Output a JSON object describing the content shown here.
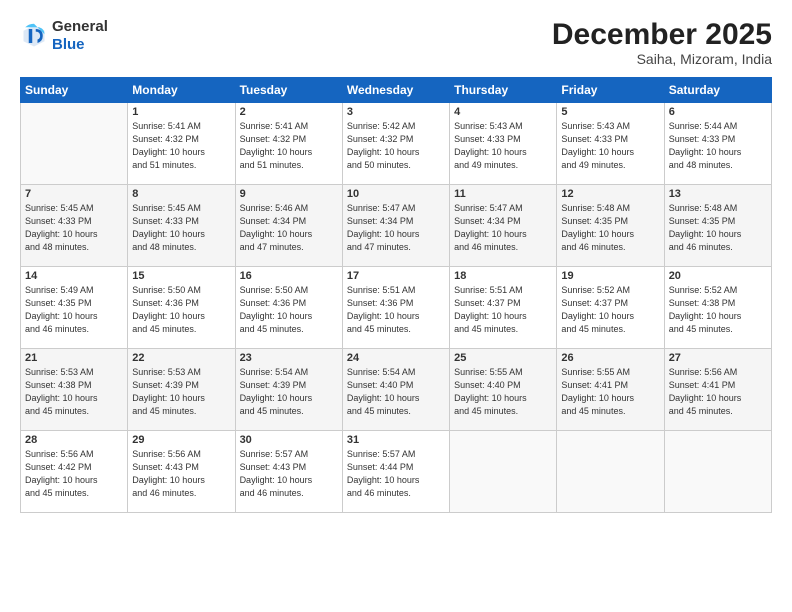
{
  "header": {
    "logo_general": "General",
    "logo_blue": "Blue",
    "month_title": "December 2025",
    "location": "Saiha, Mizoram, India"
  },
  "weekdays": [
    "Sunday",
    "Monday",
    "Tuesday",
    "Wednesday",
    "Thursday",
    "Friday",
    "Saturday"
  ],
  "weeks": [
    [
      {
        "num": "",
        "info": ""
      },
      {
        "num": "1",
        "info": "Sunrise: 5:41 AM\nSunset: 4:32 PM\nDaylight: 10 hours\nand 51 minutes."
      },
      {
        "num": "2",
        "info": "Sunrise: 5:41 AM\nSunset: 4:32 PM\nDaylight: 10 hours\nand 51 minutes."
      },
      {
        "num": "3",
        "info": "Sunrise: 5:42 AM\nSunset: 4:32 PM\nDaylight: 10 hours\nand 50 minutes."
      },
      {
        "num": "4",
        "info": "Sunrise: 5:43 AM\nSunset: 4:33 PM\nDaylight: 10 hours\nand 49 minutes."
      },
      {
        "num": "5",
        "info": "Sunrise: 5:43 AM\nSunset: 4:33 PM\nDaylight: 10 hours\nand 49 minutes."
      },
      {
        "num": "6",
        "info": "Sunrise: 5:44 AM\nSunset: 4:33 PM\nDaylight: 10 hours\nand 48 minutes."
      }
    ],
    [
      {
        "num": "7",
        "info": "Sunrise: 5:45 AM\nSunset: 4:33 PM\nDaylight: 10 hours\nand 48 minutes."
      },
      {
        "num": "8",
        "info": "Sunrise: 5:45 AM\nSunset: 4:33 PM\nDaylight: 10 hours\nand 48 minutes."
      },
      {
        "num": "9",
        "info": "Sunrise: 5:46 AM\nSunset: 4:34 PM\nDaylight: 10 hours\nand 47 minutes."
      },
      {
        "num": "10",
        "info": "Sunrise: 5:47 AM\nSunset: 4:34 PM\nDaylight: 10 hours\nand 47 minutes."
      },
      {
        "num": "11",
        "info": "Sunrise: 5:47 AM\nSunset: 4:34 PM\nDaylight: 10 hours\nand 46 minutes."
      },
      {
        "num": "12",
        "info": "Sunrise: 5:48 AM\nSunset: 4:35 PM\nDaylight: 10 hours\nand 46 minutes."
      },
      {
        "num": "13",
        "info": "Sunrise: 5:48 AM\nSunset: 4:35 PM\nDaylight: 10 hours\nand 46 minutes."
      }
    ],
    [
      {
        "num": "14",
        "info": "Sunrise: 5:49 AM\nSunset: 4:35 PM\nDaylight: 10 hours\nand 46 minutes."
      },
      {
        "num": "15",
        "info": "Sunrise: 5:50 AM\nSunset: 4:36 PM\nDaylight: 10 hours\nand 45 minutes."
      },
      {
        "num": "16",
        "info": "Sunrise: 5:50 AM\nSunset: 4:36 PM\nDaylight: 10 hours\nand 45 minutes."
      },
      {
        "num": "17",
        "info": "Sunrise: 5:51 AM\nSunset: 4:36 PM\nDaylight: 10 hours\nand 45 minutes."
      },
      {
        "num": "18",
        "info": "Sunrise: 5:51 AM\nSunset: 4:37 PM\nDaylight: 10 hours\nand 45 minutes."
      },
      {
        "num": "19",
        "info": "Sunrise: 5:52 AM\nSunset: 4:37 PM\nDaylight: 10 hours\nand 45 minutes."
      },
      {
        "num": "20",
        "info": "Sunrise: 5:52 AM\nSunset: 4:38 PM\nDaylight: 10 hours\nand 45 minutes."
      }
    ],
    [
      {
        "num": "21",
        "info": "Sunrise: 5:53 AM\nSunset: 4:38 PM\nDaylight: 10 hours\nand 45 minutes."
      },
      {
        "num": "22",
        "info": "Sunrise: 5:53 AM\nSunset: 4:39 PM\nDaylight: 10 hours\nand 45 minutes."
      },
      {
        "num": "23",
        "info": "Sunrise: 5:54 AM\nSunset: 4:39 PM\nDaylight: 10 hours\nand 45 minutes."
      },
      {
        "num": "24",
        "info": "Sunrise: 5:54 AM\nSunset: 4:40 PM\nDaylight: 10 hours\nand 45 minutes."
      },
      {
        "num": "25",
        "info": "Sunrise: 5:55 AM\nSunset: 4:40 PM\nDaylight: 10 hours\nand 45 minutes."
      },
      {
        "num": "26",
        "info": "Sunrise: 5:55 AM\nSunset: 4:41 PM\nDaylight: 10 hours\nand 45 minutes."
      },
      {
        "num": "27",
        "info": "Sunrise: 5:56 AM\nSunset: 4:41 PM\nDaylight: 10 hours\nand 45 minutes."
      }
    ],
    [
      {
        "num": "28",
        "info": "Sunrise: 5:56 AM\nSunset: 4:42 PM\nDaylight: 10 hours\nand 45 minutes."
      },
      {
        "num": "29",
        "info": "Sunrise: 5:56 AM\nSunset: 4:43 PM\nDaylight: 10 hours\nand 46 minutes."
      },
      {
        "num": "30",
        "info": "Sunrise: 5:57 AM\nSunset: 4:43 PM\nDaylight: 10 hours\nand 46 minutes."
      },
      {
        "num": "31",
        "info": "Sunrise: 5:57 AM\nSunset: 4:44 PM\nDaylight: 10 hours\nand 46 minutes."
      },
      {
        "num": "",
        "info": ""
      },
      {
        "num": "",
        "info": ""
      },
      {
        "num": "",
        "info": ""
      }
    ]
  ]
}
